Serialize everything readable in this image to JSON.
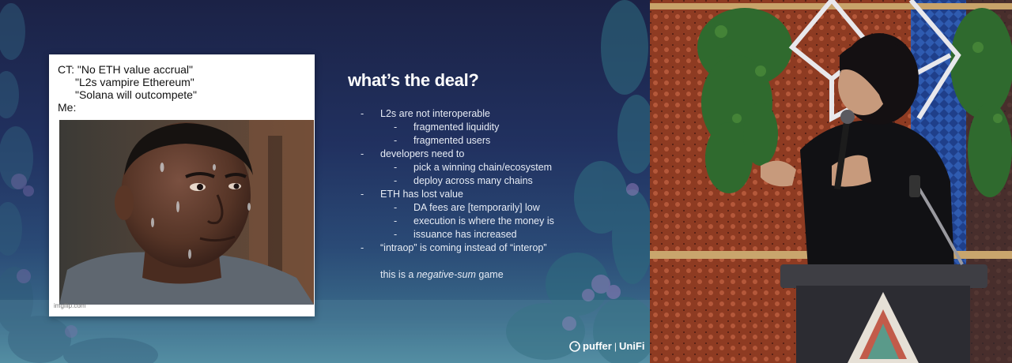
{
  "meme": {
    "lines": [
      "CT: \"No ETH value accrual\"",
      "\"L2s vampire Ethereum\"",
      "\"Solana will outcompete\"",
      "Me:"
    ],
    "watermark": "imgflip.com"
  },
  "slide": {
    "title": "what’s the deal?",
    "bullets": [
      {
        "level": 1,
        "text": "L2s are not interoperable"
      },
      {
        "level": 2,
        "text": "fragmented liquidity"
      },
      {
        "level": 2,
        "text": "fragmented users"
      },
      {
        "level": 1,
        "text": "developers need to"
      },
      {
        "level": 2,
        "text": "pick a winning chain/ecosystem"
      },
      {
        "level": 2,
        "text": "deploy across many chains"
      },
      {
        "level": 1,
        "text": "ETH has lost value"
      },
      {
        "level": 2,
        "text": "DA fees are [temporarily] low"
      },
      {
        "level": 2,
        "text": "execution is where the money is"
      },
      {
        "level": 2,
        "text": "issuance has increased"
      },
      {
        "level": 1,
        "text": "“intraop” is coming instead of “interop”"
      }
    ],
    "dash": "-",
    "footer": {
      "prefix": "this is a ",
      "emphasis": "negative-sum",
      "suffix": " game"
    },
    "brand": {
      "left": "puffer",
      "separator": "|",
      "right": "UniFi"
    }
  }
}
